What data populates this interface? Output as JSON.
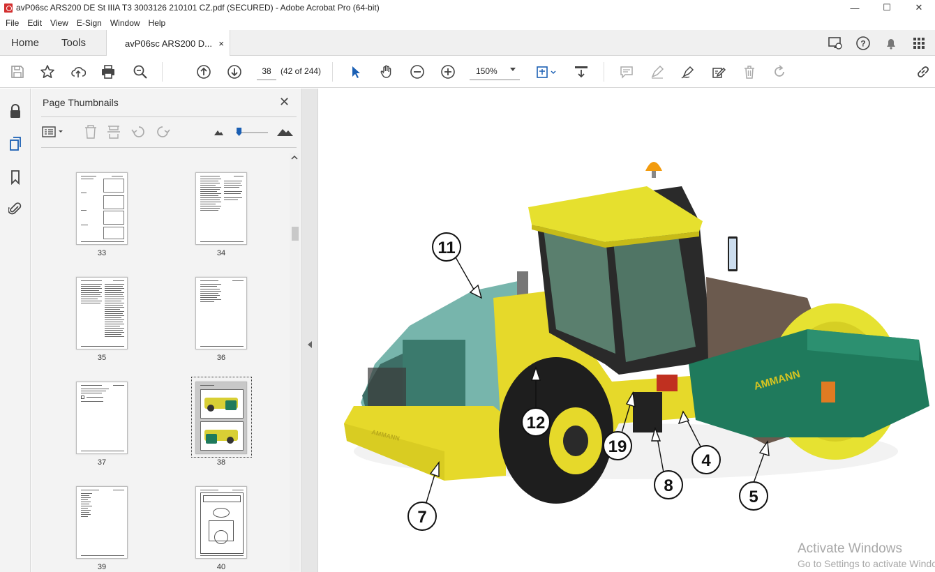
{
  "window": {
    "title": "avP06sc ARS200 DE St IIIA T3 3003126 210101 CZ.pdf (SECURED) - Adobe Acrobat Pro (64-bit)"
  },
  "menu": [
    "File",
    "Edit",
    "View",
    "E-Sign",
    "Window",
    "Help"
  ],
  "tabs": {
    "home": "Home",
    "tools": "Tools",
    "document": "avP06sc ARS200 D...",
    "close": "×"
  },
  "toolbar": {
    "current_page": "38",
    "page_count": "(42 of 244)",
    "zoom": "150%"
  },
  "panel": {
    "title": "Page Thumbnails",
    "close": "✕",
    "thumbnails": [
      {
        "page": "33"
      },
      {
        "page": "34"
      },
      {
        "page": "35"
      },
      {
        "page": "36"
      },
      {
        "page": "37"
      },
      {
        "page": "38",
        "selected": true
      },
      {
        "page": "39"
      },
      {
        "page": "40"
      }
    ],
    "thumb_size": 0.1
  },
  "document": {
    "callouts": [
      "11",
      "12",
      "19",
      "8",
      "4",
      "5",
      "7"
    ],
    "brand_text": "AMMANN"
  },
  "watermark": {
    "line1": "Activate Windows",
    "line2": "Go to Settings to activate Windows."
  },
  "colors": {
    "acrobat_red": "#d32f2f",
    "machine_yellow": "#e6d92a",
    "machine_green": "#1f7a5c",
    "tool_blue": "#1a5fb4"
  }
}
